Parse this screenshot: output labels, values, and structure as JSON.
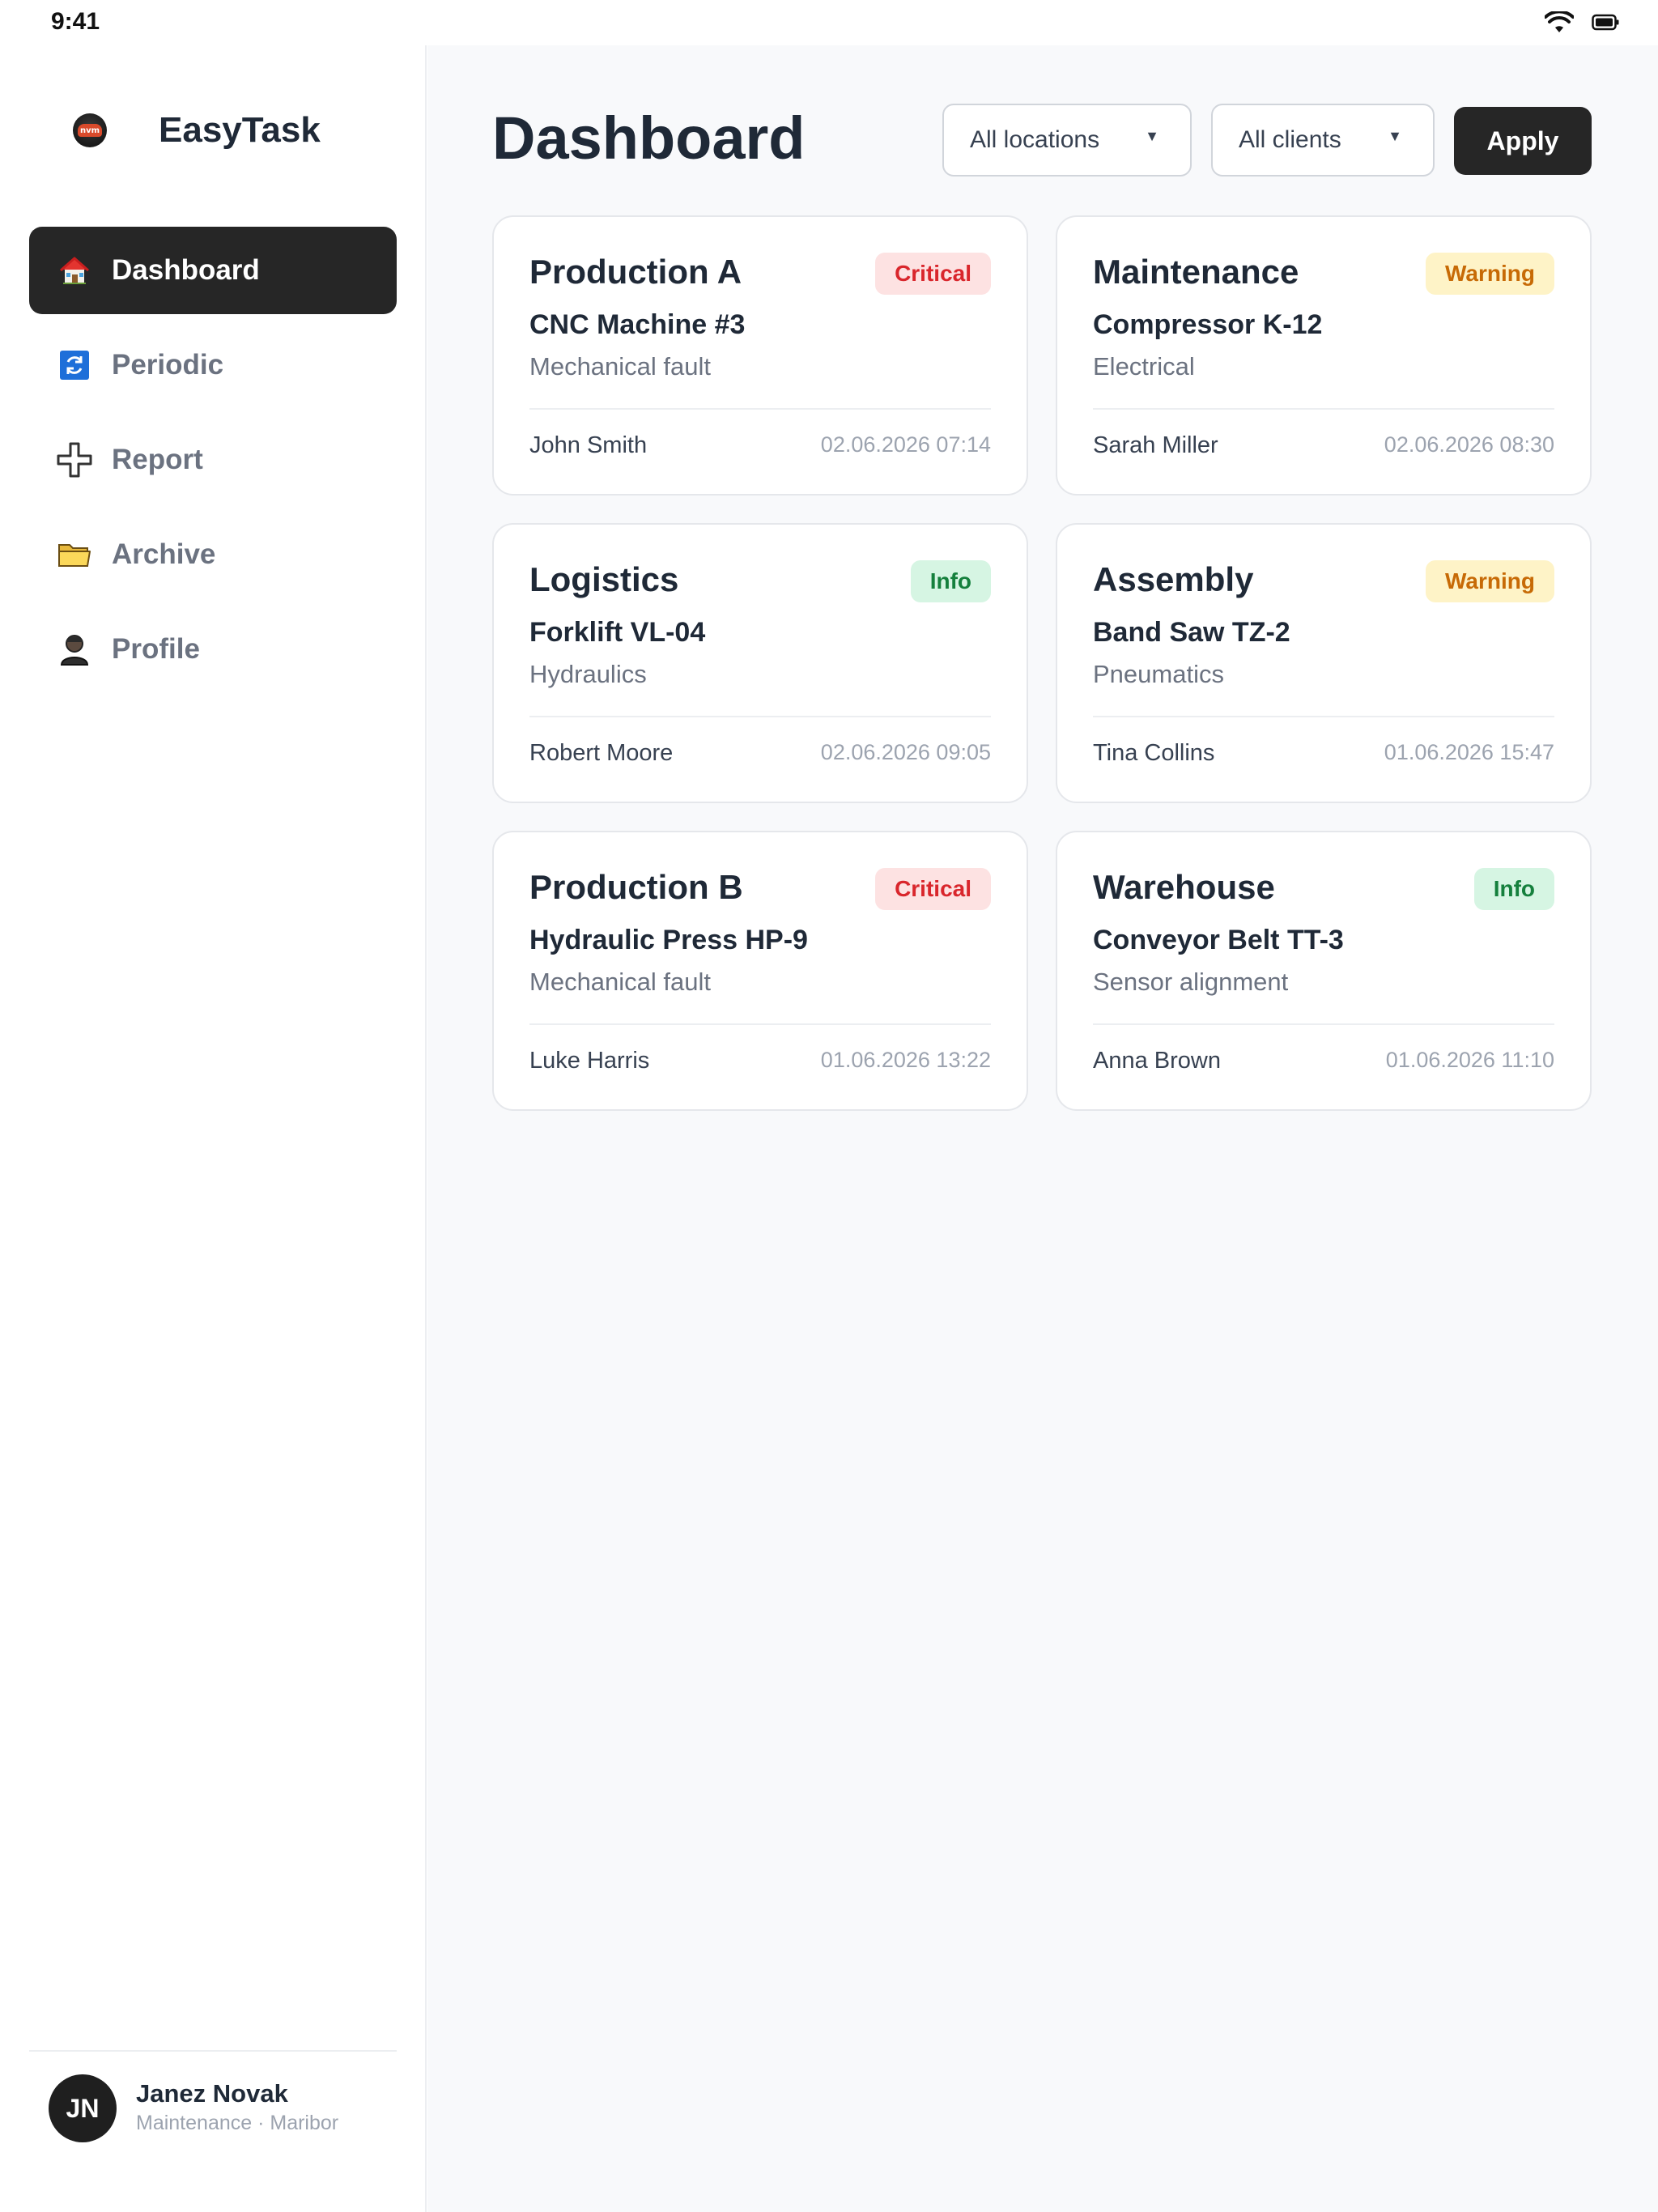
{
  "status_bar": {
    "time": "9:41",
    "icons": [
      "wifi-icon",
      "battery-icon"
    ]
  },
  "app": {
    "name": "EasyTask",
    "logo_text": "nvm"
  },
  "sidebar": {
    "items": [
      {
        "label": "Dashboard",
        "icon": "home-icon",
        "active": true
      },
      {
        "label": "Periodic",
        "icon": "refresh-icon",
        "active": false
      },
      {
        "label": "Report",
        "icon": "plus-icon",
        "active": false
      },
      {
        "label": "Archive",
        "icon": "folder-icon",
        "active": false
      },
      {
        "label": "Profile",
        "icon": "person-icon",
        "active": false
      }
    ],
    "user": {
      "initials": "JN",
      "name": "Janez Novak",
      "role": "Maintenance · Maribor"
    }
  },
  "header": {
    "title": "Dashboard",
    "location_filter": "All locations",
    "client_filter": "All clients",
    "apply_label": "Apply"
  },
  "cards": [
    {
      "location": "Production A",
      "severity": "Critical",
      "machine": "CNC Machine #3",
      "type": "Mechanical fault",
      "person": "John Smith",
      "time": "02.06.2026 07:14"
    },
    {
      "location": "Maintenance",
      "severity": "Warning",
      "machine": "Compressor K-12",
      "type": "Electrical",
      "person": "Sarah Miller",
      "time": "02.06.2026 08:30"
    },
    {
      "location": "Logistics",
      "severity": "Info",
      "machine": "Forklift VL-04",
      "type": "Hydraulics",
      "person": "Robert Moore",
      "time": "02.06.2026 09:05"
    },
    {
      "location": "Assembly",
      "severity": "Warning",
      "machine": "Band Saw TZ-2",
      "type": "Pneumatics",
      "person": "Tina Collins",
      "time": "01.06.2026 15:47"
    },
    {
      "location": "Production B",
      "severity": "Critical",
      "machine": "Hydraulic Press HP-9",
      "type": "Mechanical fault",
      "person": "Luke Harris",
      "time": "01.06.2026 13:22"
    },
    {
      "location": "Warehouse",
      "severity": "Info",
      "machine": "Conveyor Belt TT-3",
      "type": "Sensor alignment",
      "person": "Anna Brown",
      "time": "01.06.2026 11:10"
    }
  ],
  "colors": {
    "active_nav": "#262626",
    "critical_bg": "#fde2e2",
    "critical_text": "#d9262c",
    "warning_bg": "#fef3c7",
    "warning_text": "#c76a06",
    "info_bg": "#d6f5e3",
    "info_text": "#15803d"
  }
}
